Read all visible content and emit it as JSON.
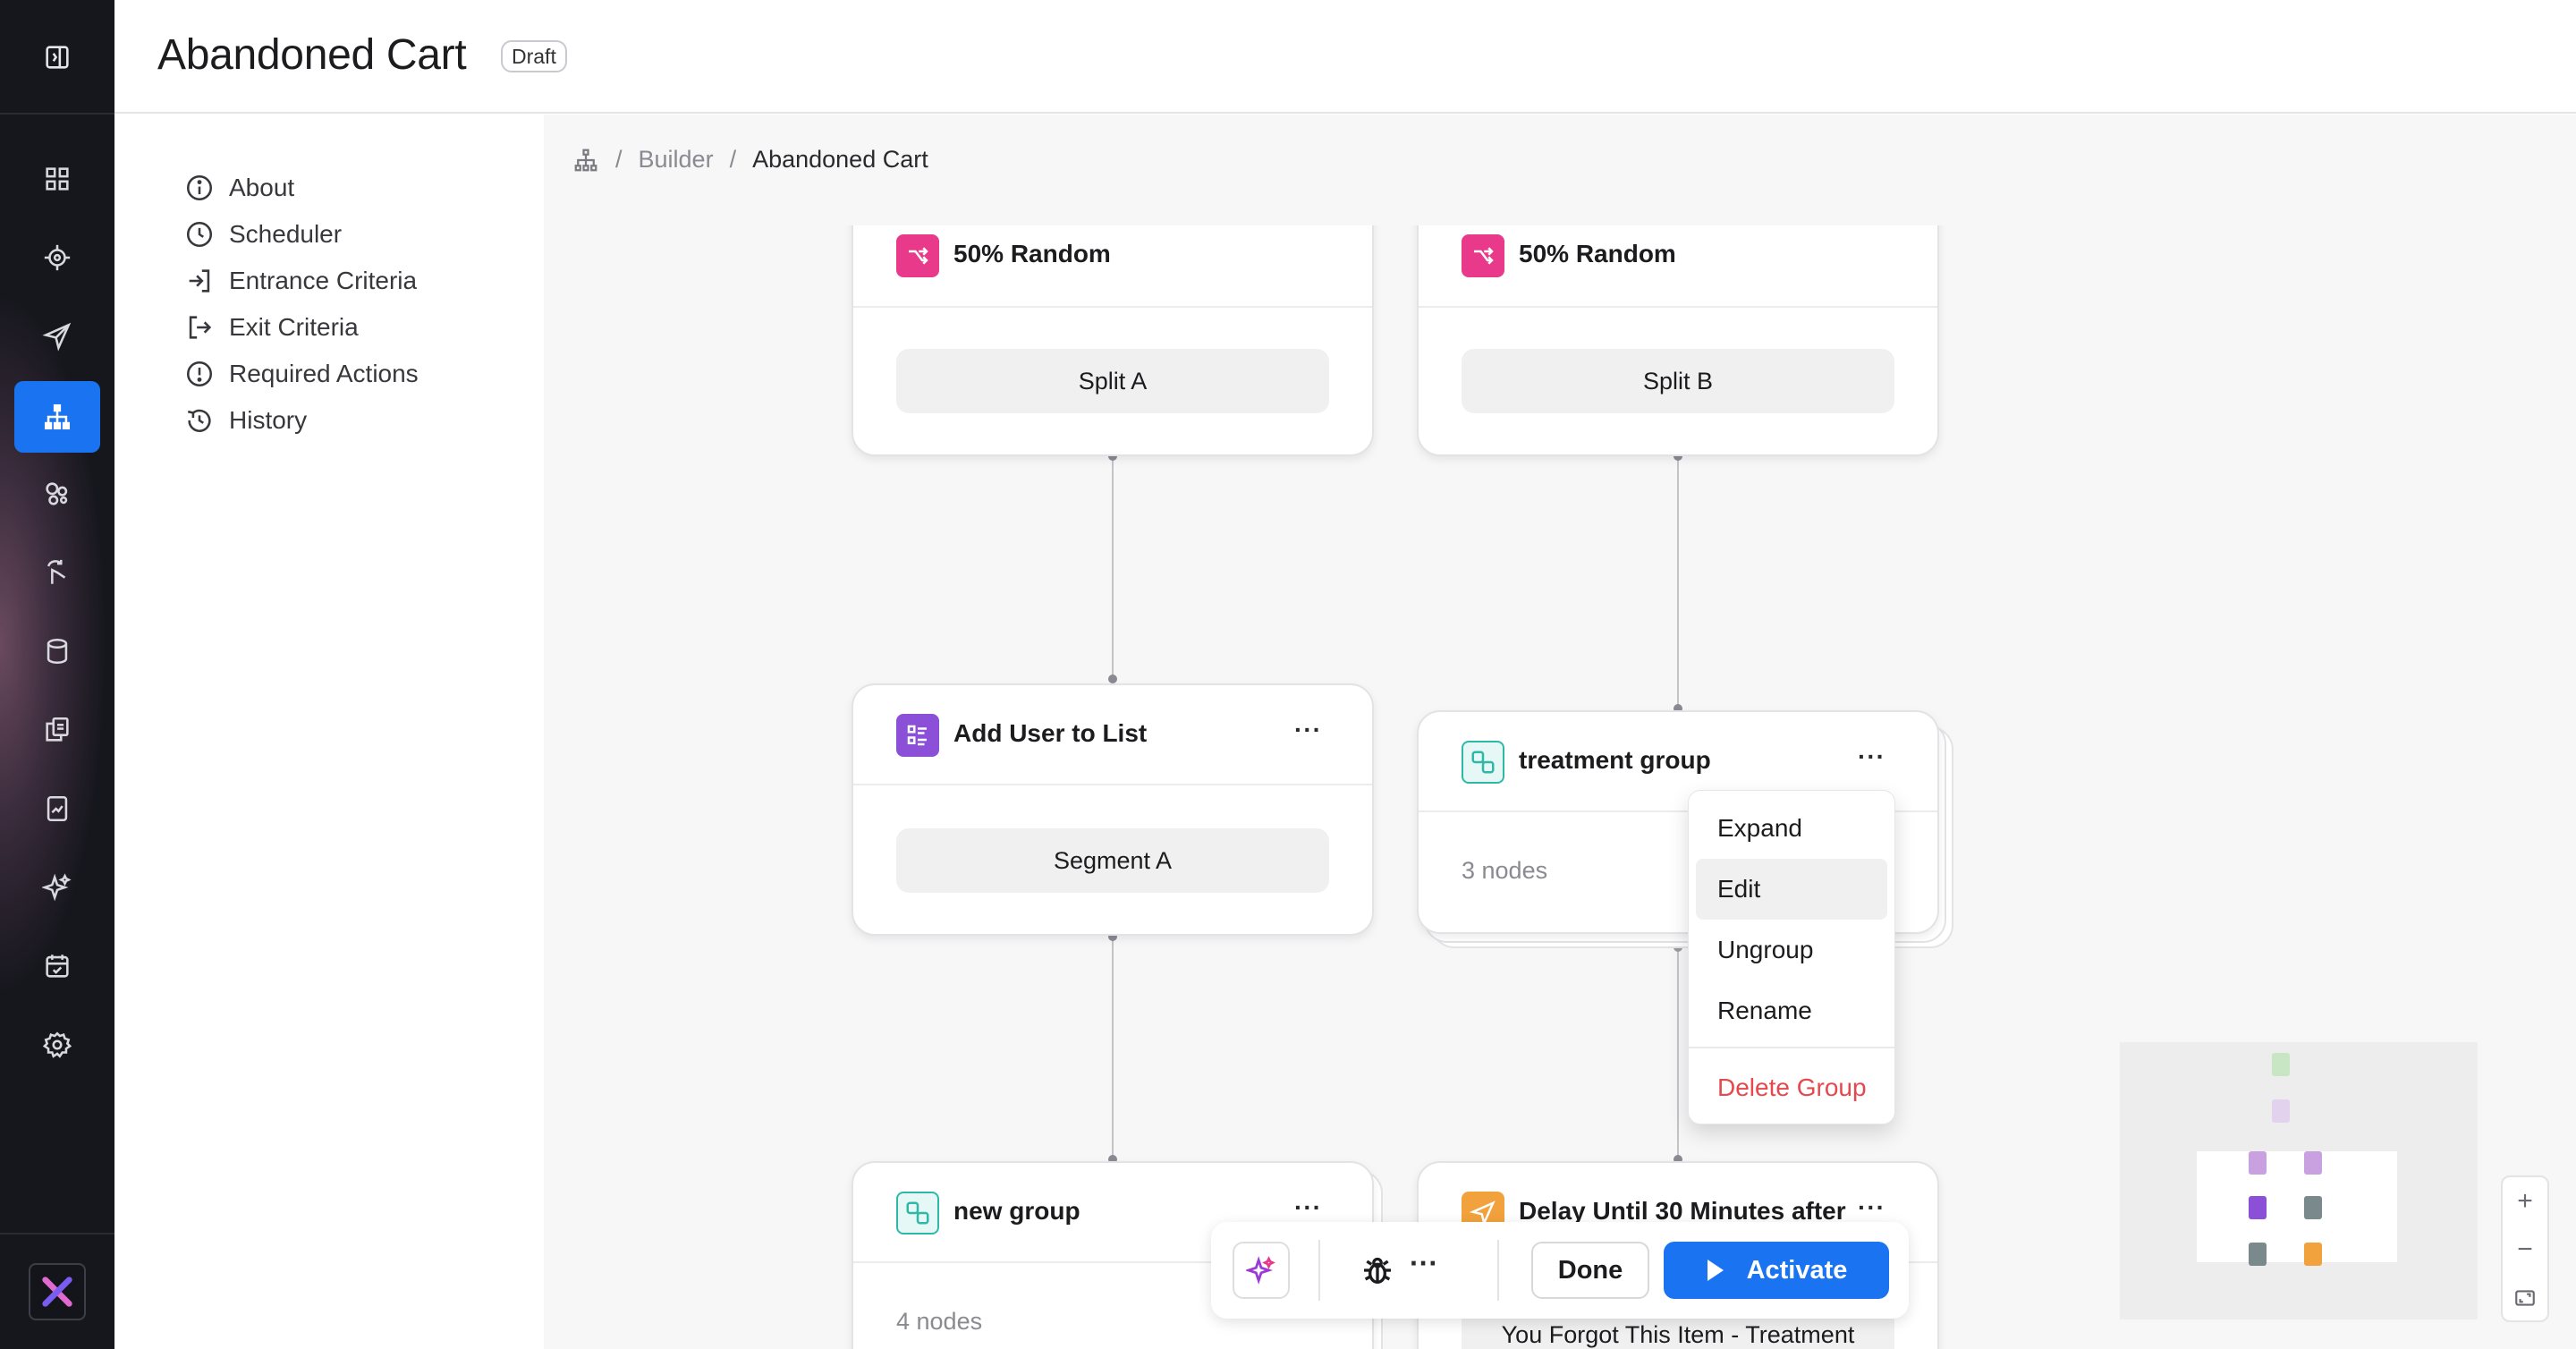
{
  "header": {
    "title": "Abandoned Cart",
    "status_badge": "Draft"
  },
  "left_nav": {
    "items": [
      {
        "label": "About",
        "icon": "info-icon"
      },
      {
        "label": "Scheduler",
        "icon": "clock-icon"
      },
      {
        "label": "Entrance Criteria",
        "icon": "enter-icon"
      },
      {
        "label": "Exit Criteria",
        "icon": "exit-icon"
      },
      {
        "label": "Required Actions",
        "icon": "alert-icon"
      },
      {
        "label": "History",
        "icon": "history-icon"
      }
    ]
  },
  "rail": {
    "icons": [
      "panel-toggle-icon",
      "dashboard-icon",
      "target-icon",
      "send-icon",
      "journey-icon",
      "segments-icon",
      "cursor-icon",
      "database-icon",
      "copy-icon",
      "report-icon",
      "sparkle-icon",
      "calendar-icon",
      "settings-icon",
      "brand-logo-icon"
    ],
    "active": "journey-icon"
  },
  "breadcrumb": {
    "root_icon": "sitemap-icon",
    "items": [
      "Builder",
      "Abandoned Cart"
    ]
  },
  "nodes": {
    "split_a": {
      "title": "50% Random",
      "pill": "Split A"
    },
    "split_b": {
      "title": "50% Random",
      "pill": "Split B"
    },
    "add_user": {
      "title": "Add User to List",
      "more": "···",
      "pill": "Segment A"
    },
    "treatment": {
      "title": "treatment group",
      "more": "···",
      "count": "3 nodes"
    },
    "new_group": {
      "title": "new group",
      "more": "···",
      "count": "4 nodes"
    },
    "delay": {
      "title": "Delay Until 30 Minutes after",
      "more": "···",
      "pill": "You Forgot This Item - Treatment"
    }
  },
  "context_menu": {
    "items": [
      "Expand",
      "Edit",
      "Ungroup",
      "Rename"
    ],
    "danger_item": "Delete Group",
    "hovered": "Edit"
  },
  "toolbar": {
    "more": "···",
    "done_label": "Done",
    "activate_label": "Activate"
  },
  "zoom": {
    "in": "+",
    "out": "−"
  },
  "colors": {
    "accent": "#1a74f2",
    "split_icon": "#e8398a",
    "list_icon": "#8b4fd8",
    "group_icon": "#2fb8a8",
    "delay_icon": "#f2a23c",
    "danger": "#e5484d"
  }
}
